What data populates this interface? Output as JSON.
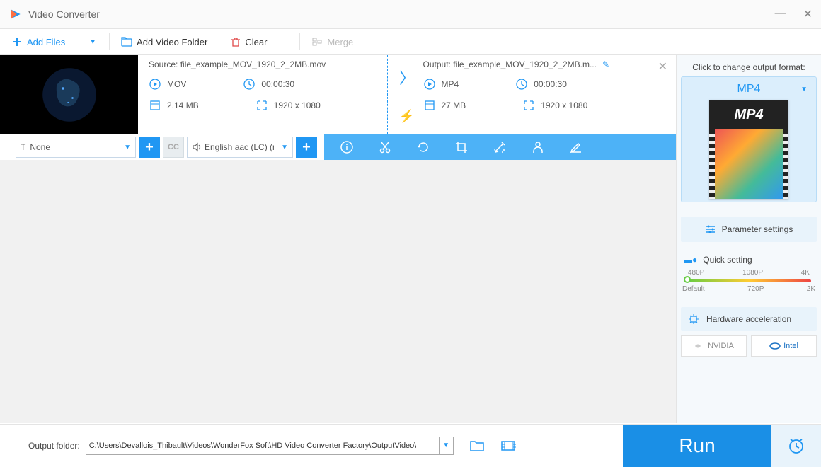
{
  "window": {
    "title": "Video Converter"
  },
  "toolbar": {
    "add_files": "Add Files",
    "add_folder": "Add Video Folder",
    "clear": "Clear",
    "merge": "Merge"
  },
  "file": {
    "source_label": "Source:",
    "source_name": "file_example_MOV_1920_2_2MB.mov",
    "output_label": "Output:",
    "output_name": "file_example_MOV_1920_2_2MB.m...",
    "src": {
      "format": "MOV",
      "duration": "00:00:30",
      "size": "2.14 MB",
      "resolution": "1920 x 1080"
    },
    "out": {
      "format": "MP4",
      "duration": "00:00:30",
      "size": "27 MB",
      "resolution": "1920 x 1080"
    }
  },
  "actions": {
    "subtitle_select": "None",
    "audio_select": "English aac (LC) (mp"
  },
  "right": {
    "change_label": "Click to change output format:",
    "format": "MP4",
    "thumb_label": "MP4",
    "param_settings": "Parameter settings",
    "quick_setting": "Quick setting",
    "slider": {
      "t1": "480P",
      "t2": "1080P",
      "t3": "4K",
      "b1": "Default",
      "b2": "720P",
      "b3": "2K"
    },
    "hw_accel": "Hardware acceleration",
    "nvidia": "NVIDIA",
    "intel": "Intel"
  },
  "bottom": {
    "label": "Output folder:",
    "path": "C:\\Users\\Devallois_Thibault\\Videos\\WonderFox Soft\\HD Video Converter Factory\\OutputVideo\\",
    "run": "Run"
  }
}
